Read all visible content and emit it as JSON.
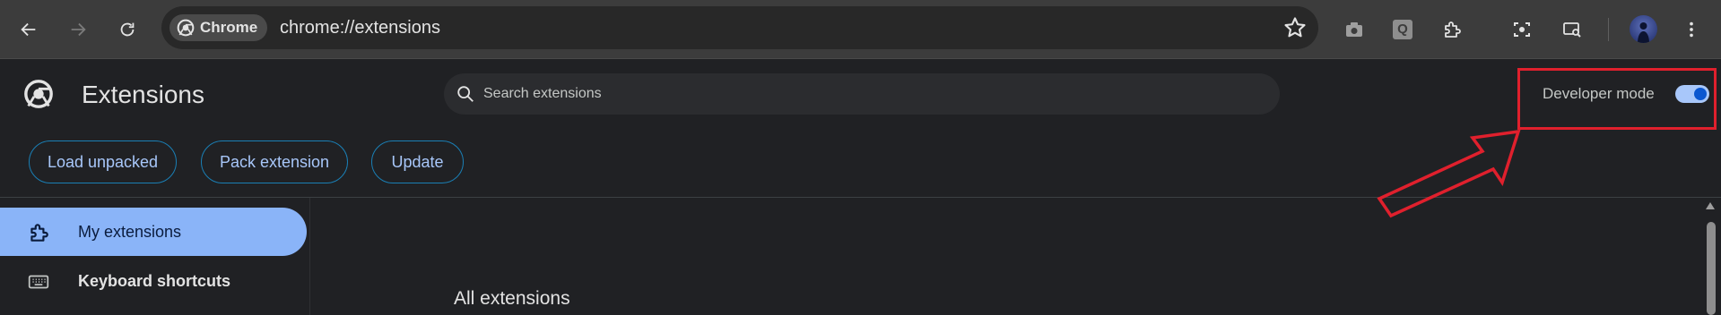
{
  "browser": {
    "chip_label": "Chrome",
    "url": "chrome://extensions",
    "icons": {
      "back": "arrow-left-icon",
      "forward": "arrow-right-icon",
      "reload": "reload-icon",
      "bookmark": "star-icon",
      "ext1": "camera-icon",
      "ext2": "q-icon",
      "ext3": "puzzle-icon",
      "ext4": "screenshot-icon",
      "ext5": "search-screen-icon",
      "menu": "kebab-menu-icon"
    },
    "ext2_letter": "Q"
  },
  "header": {
    "title": "Extensions",
    "search_placeholder": "Search extensions",
    "developer_mode_label": "Developer mode",
    "developer_mode_on": true
  },
  "actions": {
    "load_unpacked": "Load unpacked",
    "pack_extension": "Pack extension",
    "update": "Update"
  },
  "sidebar": {
    "items": [
      {
        "label": "My extensions",
        "icon": "puzzle-icon",
        "active": true
      },
      {
        "label": "Keyboard shortcuts",
        "icon": "keyboard-icon",
        "active": false
      }
    ]
  },
  "main": {
    "section_title": "All extensions"
  },
  "colors": {
    "background": "#202124",
    "toolbar": "#3c3c3c",
    "accent": "#a8c7fa",
    "active_nav": "#8ab4f8",
    "annotation": "#e0202d"
  }
}
